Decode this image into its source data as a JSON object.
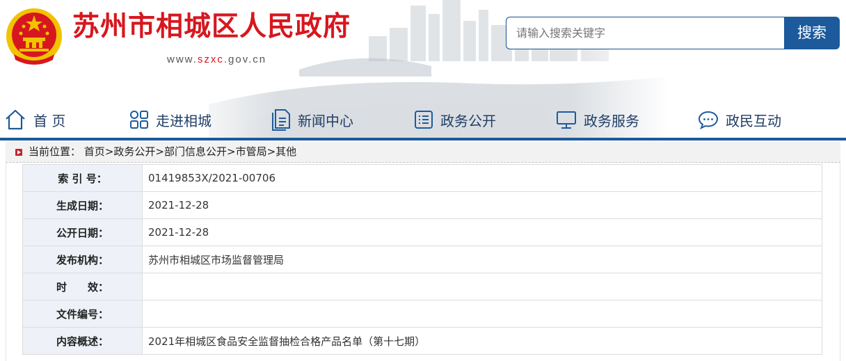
{
  "header": {
    "site_title": "苏州市相城区人民政府",
    "domain_prefix": "www.",
    "domain_highlight": "szxc",
    "domain_suffix": ".gov.cn",
    "search_placeholder": "请输入搜索关键字",
    "search_button": "搜索"
  },
  "nav": {
    "items": [
      {
        "label": "首 页",
        "icon": "home-icon"
      },
      {
        "label": "走进相城",
        "icon": "grid-icon"
      },
      {
        "label": "新闻中心",
        "icon": "document-icon"
      },
      {
        "label": "政务公开",
        "icon": "list-icon"
      },
      {
        "label": "政务服务",
        "icon": "monitor-icon"
      },
      {
        "label": "政民互动",
        "icon": "chat-icon"
      }
    ]
  },
  "breadcrumb": {
    "prefix": "当前位置：",
    "items": [
      "首页",
      "政务公开",
      "部门信息公开",
      "市管局",
      "其他"
    ],
    "separator": ">"
  },
  "info_table": {
    "rows": [
      {
        "key": "索 引 号：",
        "value": "01419853X/2021-00706"
      },
      {
        "key": "生成日期：",
        "value": "2021-12-28"
      },
      {
        "key": "公开日期：",
        "value": "2021-12-28"
      },
      {
        "key": "发布机构：",
        "value": "苏州市相城区市场监督管理局"
      },
      {
        "key": "时　　效：",
        "value": ""
      },
      {
        "key": "文件编号：",
        "value": ""
      },
      {
        "key": "内容概述：",
        "value": "2021年相城区食品安全监督抽检合格产品名单（第十七期）"
      }
    ]
  },
  "colors": {
    "brand_red": "#d7171f",
    "nav_blue": "#1d5a9c",
    "nav_text": "#1f3d66",
    "table_key_bg": "#eef2f8"
  }
}
